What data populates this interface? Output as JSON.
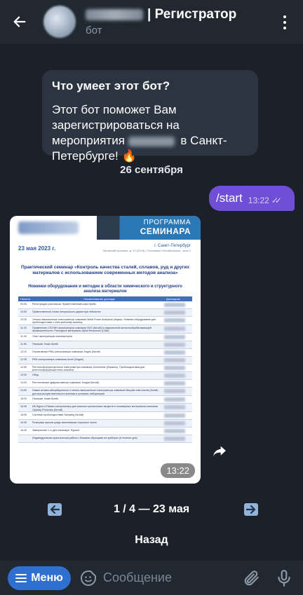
{
  "header": {
    "title_suffix": "| Регистратор",
    "subtitle": "бот",
    "back_icon": "arrow-left-icon",
    "more_icon": "more-vertical-icon"
  },
  "chat": {
    "bot_intro": {
      "title": "Что умеет этот бот?",
      "text_before": "Этот бот поможет Вам зарегистрироваться на мероприятия",
      "text_after": "в Санкт-Петербурге! 🔥"
    },
    "date_separator": "26 сентября",
    "outgoing": {
      "text": "/start",
      "time": "13:22",
      "status": "✓✓"
    },
    "image_message": {
      "time": "13:22",
      "doc": {
        "banner_line1": "ПРОГРАММА",
        "banner_line2": "СЕМИНАРА",
        "date": "23 мая 2023 г.",
        "city": "г. Санкт-Петербург",
        "address": "Лиговский проспект, д. 10 (2023) | Гостиница «Октябрьская», зона 2",
        "heading": "Практический семинар «Контроль качества сталей, сплавов, руд и других материалов с использованием современных методов анализа»",
        "subheading": "Новинки оборудования и методик в области химического и структурного анализа материалов",
        "col_time": "Начало",
        "col_title": "Наименование доклада",
        "col_speaker": "Докладчик",
        "rows": [
          {
            "t": "09:30",
            "x": "Регистрация участников. Приветственный кофе-брейк"
          },
          {
            "t": "10:00",
            "x": "Приветственное слово генерального директора «Метатэк»"
          },
          {
            "t": "10:30",
            "x": "Оптико-эмиссионные спектрометры компании Metal Power Analytical (Индия). Новинки оборудования для пробоподготовки к спектральному анализу"
          },
          {
            "t": "11:20",
            "x": "Применение CS/ONH анализаторов компании NCS (Китай) в современной металлообрабатывающей промышленности. Расходные материалы Alpha Resources (США)"
          },
          {
            "t": "11:40",
            "x": "Опыт эксплуатации анализаторов"
          },
          {
            "t": "11:50",
            "x": "Перерыв. Кофе-брейк"
          },
          {
            "t": "12:10",
            "x": "Портативные РФА спектрометры компании Jingbo (Китай)"
          },
          {
            "t": "12:35",
            "x": "РФА спектрометры компании Anzel (Индия)"
          },
          {
            "t": "12:50",
            "x": "Рентгенофлуоресцентные спектрометры компании Xenemetrix (Израиль). Пробоподготовка для рентгенофлуоресцентного анализа"
          },
          {
            "t": "13:30",
            "x": "Обед"
          },
          {
            "t": "14:20",
            "x": "Рентгеновские дифрактометры компании Tongda (Китай)"
          },
          {
            "t": "14:50",
            "x": "Новые атомно-абсорбционные и оптико-эмиссионные спектрометры компании Macylab Instruments (Китай) для высокочувствительного анализа в условиях лаборатории"
          },
          {
            "t": "15:20",
            "x": "Перерыв. Кофе-брейк"
          },
          {
            "t": "15:35",
            "x": "ИК-Фурье и Раман-спектрометры для анализа органических веществ и полимерных материалов компании Optosky Photonics (Китай)"
          },
          {
            "t": "16:05",
            "x": "Системы пробоподготовки Sampling (Китай)"
          },
          {
            "t": "16:30",
            "x": "Розыгрыш призов среди заполнивших опросные листы"
          },
          {
            "t": "16:40",
            "x": "Завершение 1-го дня семинара. Фуршет"
          },
          {
            "t": "",
            "x": "Индивидуальная практическая работа с Вашими образцами на приборах (в течение дня)"
          }
        ]
      }
    },
    "pager": {
      "text": "1 / 4 — 23 мая",
      "prev_icon": "arrow-left-icon",
      "next_icon": "arrow-right-icon"
    },
    "back_button": "Назад"
  },
  "input_bar": {
    "menu_label": "Меню",
    "placeholder": "Сообщение",
    "emoji_icon": "sticker-icon",
    "attach_icon": "paperclip-icon",
    "mic_icon": "microphone-icon"
  },
  "colors": {
    "background": "#1c2129",
    "header": "#212830",
    "incoming_bubble": "#2b3440",
    "outgoing_bubble": "#6e4fd6",
    "menu_button": "#2f6fcf"
  }
}
